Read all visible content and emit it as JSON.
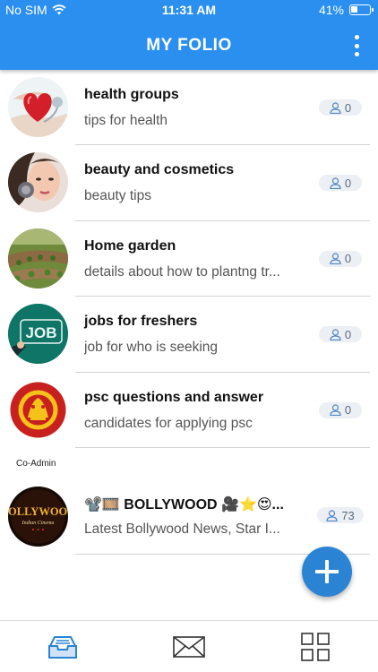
{
  "status_bar": {
    "carrier": "No SIM",
    "time": "11:31 AM",
    "battery": "41%",
    "battery_level": 0.41
  },
  "header": {
    "title": "MY FOLIO"
  },
  "folios": [
    {
      "name": "health groups",
      "description": "tips for health",
      "members": "0",
      "avatar": "heart-hands-image"
    },
    {
      "name": "beauty and  cosmetics",
      "description": "beauty tips",
      "members": "0",
      "avatar": "beauty-woman-image"
    },
    {
      "name": "Home garden",
      "description": "details about how to plantng tr...",
      "members": "0",
      "avatar": "garden-image"
    },
    {
      "name": "jobs for freshers",
      "description": "job for who is seeking",
      "members": "0",
      "avatar": "job-sign-image"
    },
    {
      "name": "psc questions and answer",
      "description": "candidates for applying psc",
      "members": "0",
      "avatar": "psc-kerala-emblem-image"
    }
  ],
  "co_admin_section": {
    "label": "Co-Admin",
    "items": [
      {
        "name": "📽️🎞️ BOLLYWOOD 🎥⭐😍...",
        "description": "Latest Bollywood News, Star I...",
        "members": "73",
        "avatar": "bollywood-logo-image",
        "avatar_text_main": "BOLLYWOOD",
        "avatar_text_sub": "Indian Cinema"
      }
    ]
  },
  "fab": {
    "icon": "plus-icon"
  },
  "bottom_nav": [
    {
      "icon": "inbox-tray-icon",
      "active": true
    },
    {
      "icon": "envelope-icon",
      "active": false
    },
    {
      "icon": "grid-icon",
      "active": false
    }
  ],
  "colors": {
    "header": "#2b8ff0",
    "fab": "#2b83d4",
    "active_nav": "#2b83d4",
    "inactive_nav": "#333333"
  }
}
